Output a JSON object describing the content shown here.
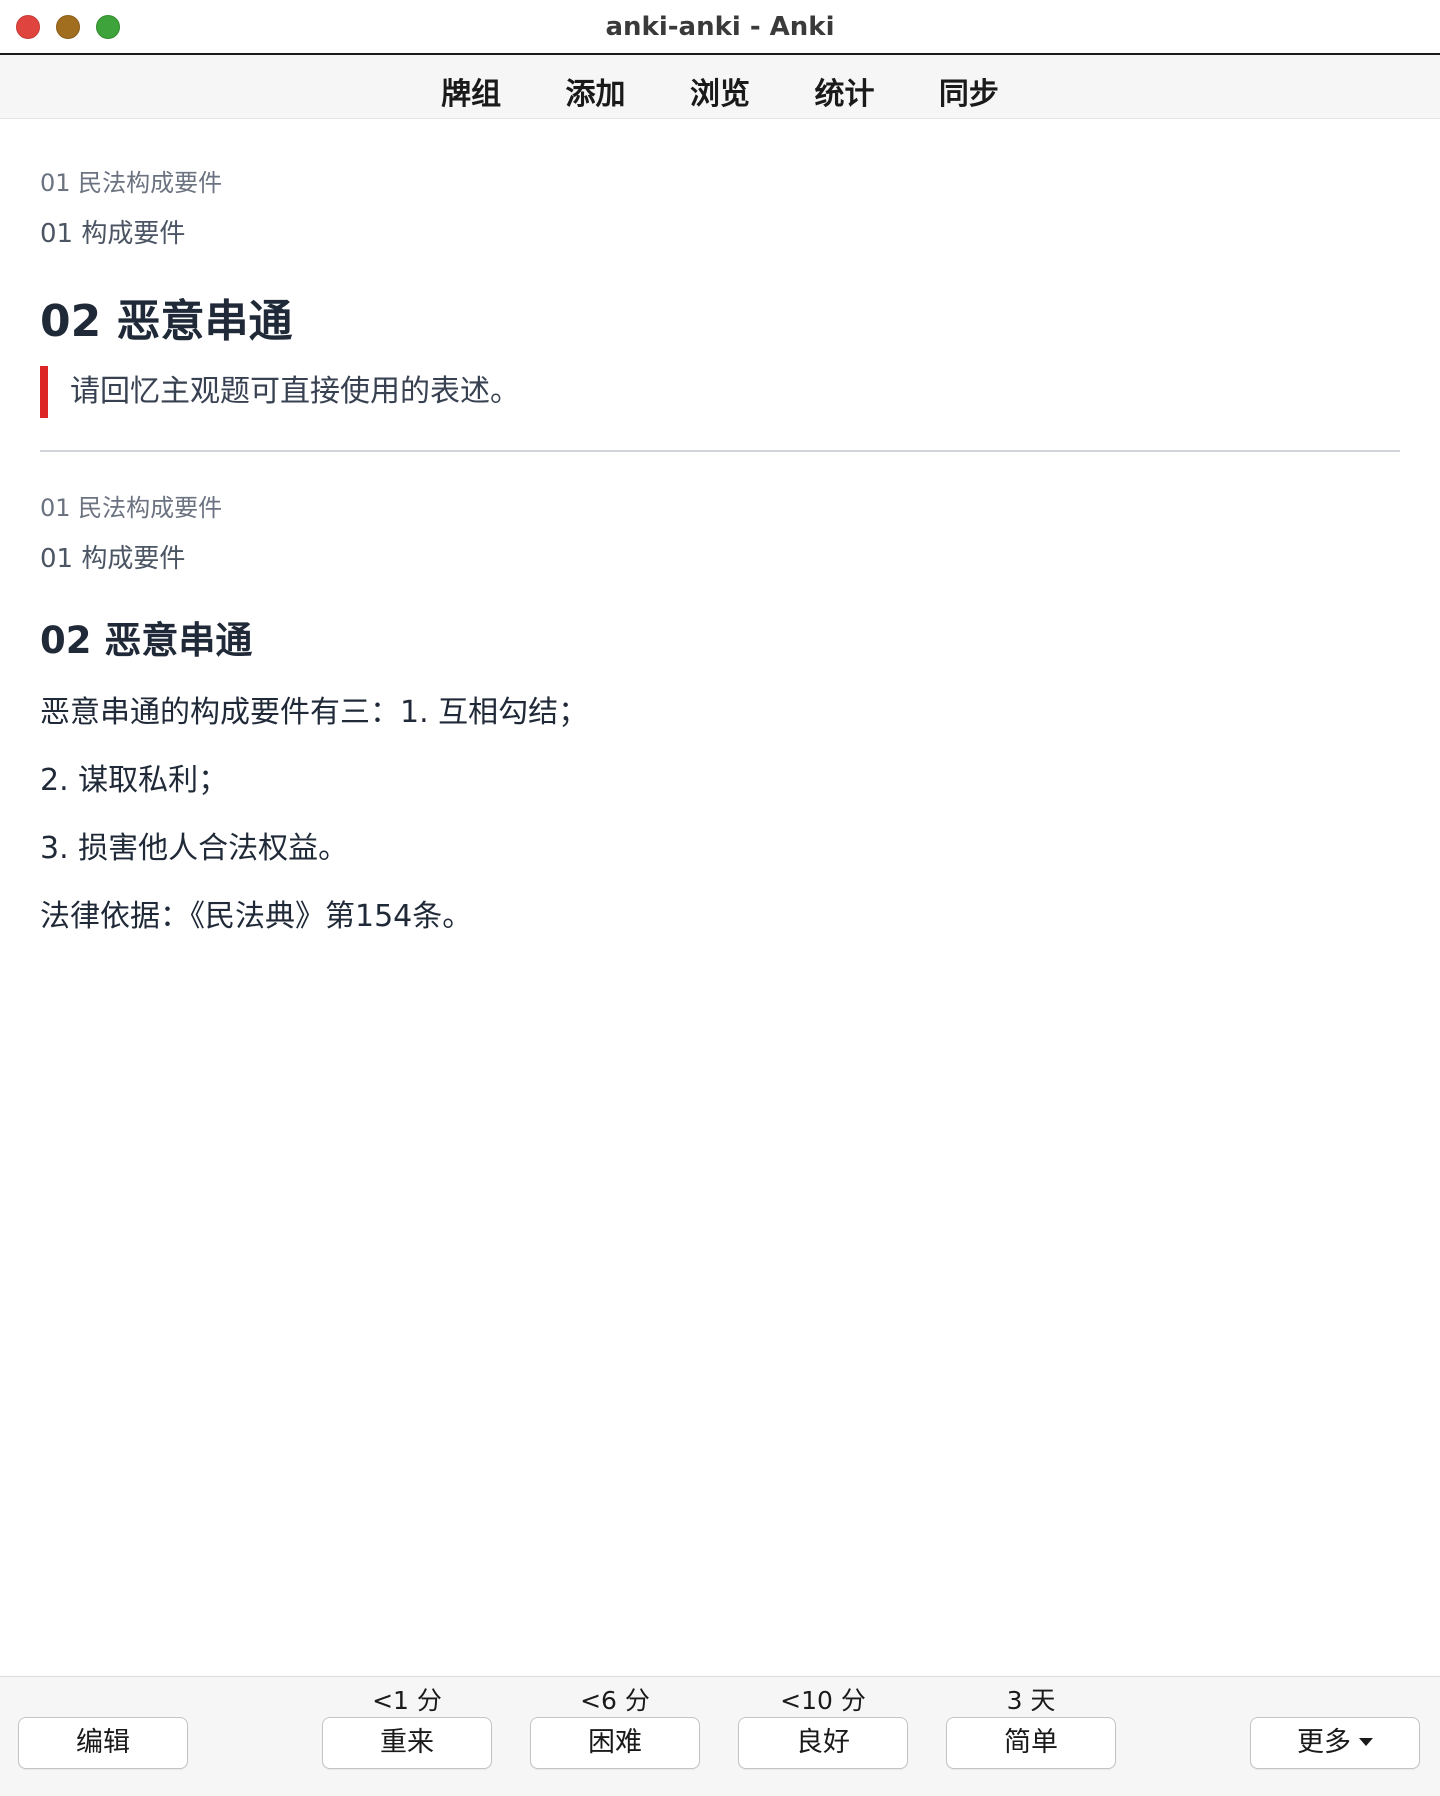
{
  "window": {
    "title": "anki-anki - Anki"
  },
  "toolbar": {
    "items": [
      {
        "label": "牌组"
      },
      {
        "label": "添加"
      },
      {
        "label": "浏览"
      },
      {
        "label": "统计"
      },
      {
        "label": "同步"
      }
    ]
  },
  "card": {
    "front": {
      "deck_path": "01 民法构成要件",
      "subdeck": "01 构成要件",
      "title": "02 恶意串通",
      "prompt": "请回忆主观题可直接使用的表述。"
    },
    "back": {
      "deck_path": "01 民法构成要件",
      "subdeck": "01 构成要件",
      "title": "02 恶意串通",
      "lines": [
        "恶意串通的构成要件有三：1. 互相勾结；",
        "2. 谋取私利；",
        "3. 损害他人合法权益。",
        "法律依据：《民法典》第154条。"
      ]
    },
    "accent_color": "#dc2626"
  },
  "bottombar": {
    "edit_label": "编辑",
    "answers": [
      {
        "interval": "<1 分",
        "label": "重来"
      },
      {
        "interval": "<6 分",
        "label": "困难"
      },
      {
        "interval": "<10 分",
        "label": "良好"
      },
      {
        "interval": "3 天",
        "label": "简单"
      }
    ],
    "more_label": "更多",
    "more_icon": "chevron-down-icon"
  }
}
